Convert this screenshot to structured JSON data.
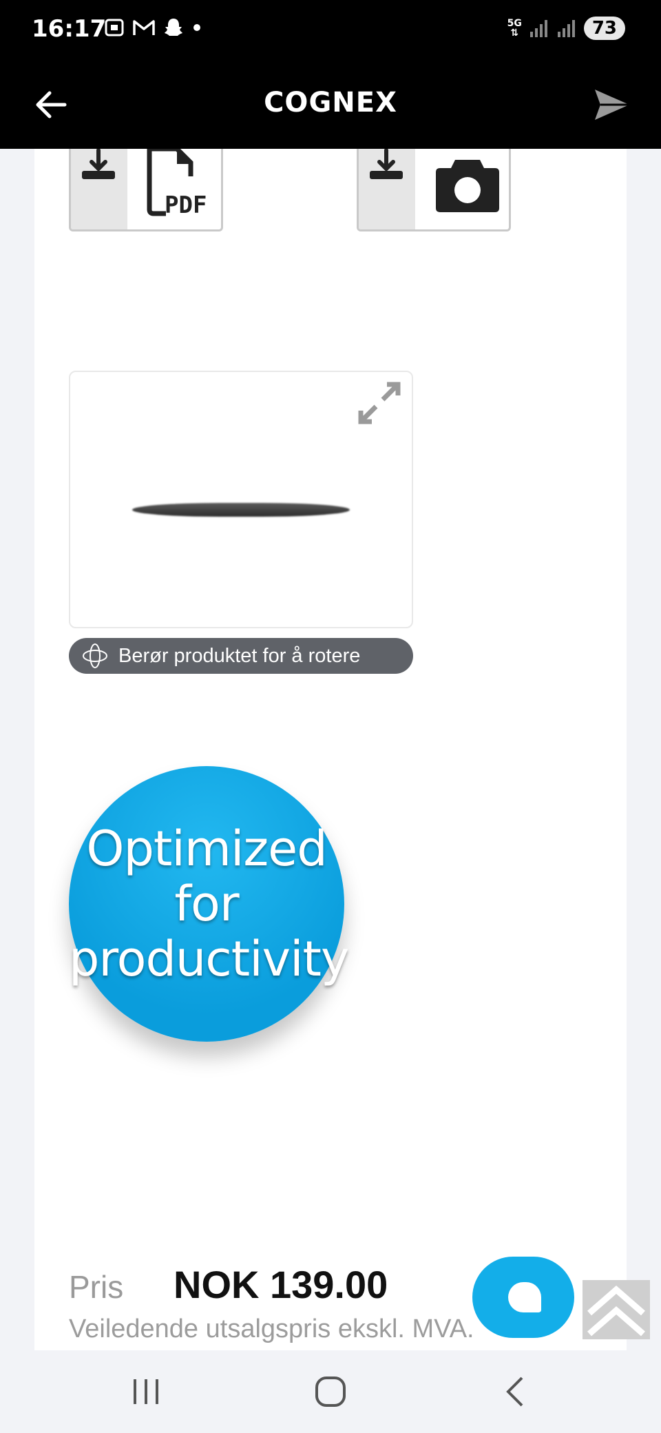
{
  "status_bar": {
    "time": "16:17",
    "network": "5G",
    "battery": "73",
    "icons": [
      "screenshot-icon",
      "gmail-icon",
      "snapchat-icon",
      "dot-icon",
      "signal-icon",
      "signal-icon"
    ]
  },
  "app_bar": {
    "brand": "COGNEX",
    "icons": [
      "back-arrow-icon",
      "send-icon"
    ]
  },
  "downloads": {
    "pdf_label": "PDF",
    "icons": [
      "download-icon",
      "pdf-file-icon",
      "camera-icon"
    ]
  },
  "viewer": {
    "rotate_hint": "Berør produktet for å rotere",
    "icons": [
      "expand-icon",
      "rotate-3d-icon"
    ]
  },
  "badge": {
    "line1": "Optimized",
    "line2": "for",
    "line3": "productivity",
    "color": "#13aee9"
  },
  "price": {
    "label": "Pris",
    "value": "NOK 139.00",
    "note": "Veiledende utsalgspris ekskl. MVA."
  },
  "floating": {
    "icons": [
      "chat-icon",
      "scroll-to-top-icon"
    ]
  },
  "nav_bar": {
    "icons": [
      "recent-apps-icon",
      "home-icon",
      "back-icon"
    ]
  }
}
